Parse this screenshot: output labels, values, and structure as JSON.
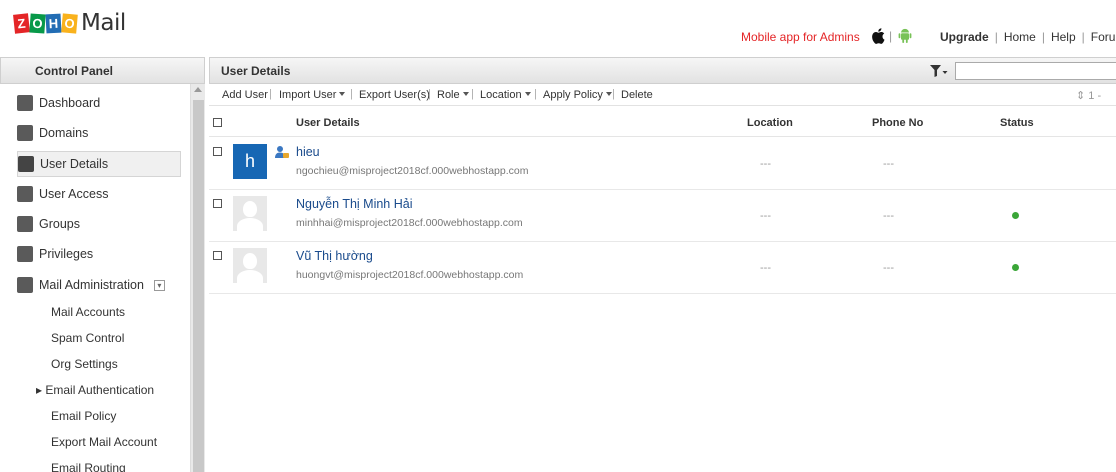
{
  "header": {
    "logo_letters": [
      "Z",
      "O",
      "H",
      "O"
    ],
    "logo_text": "Mail",
    "admin_app_link": "Mobile app for Admins",
    "icon_separator": "|",
    "apple_icon": "apple-icon",
    "android_icon": "android-icon",
    "links": [
      "Upgrade",
      "Home",
      "Help",
      "Forum"
    ],
    "separator": "|",
    "brand_colors": [
      "#e42527",
      "#089949",
      "#226db4",
      "#f9b21d"
    ],
    "accent_red": "#e42527"
  },
  "sidebar": {
    "title": "Control Panel",
    "items": [
      {
        "label": "Dashboard",
        "icon": "dashboard-icon"
      },
      {
        "label": "Domains",
        "icon": "domains-icon"
      },
      {
        "label": "User Details",
        "icon": "user-icon",
        "active": true
      },
      {
        "label": "User Access",
        "icon": "user-access-icon"
      },
      {
        "label": "Groups",
        "icon": "groups-icon"
      },
      {
        "label": "Privileges",
        "icon": "privileges-icon"
      },
      {
        "label": "Mail Administration",
        "icon": "mail-icon"
      }
    ],
    "toggle_glyph": "▾",
    "subitems": [
      {
        "label": "Mail Accounts"
      },
      {
        "label": "Spam Control"
      },
      {
        "label": "Org Settings"
      },
      {
        "label": "▸ Email Authentication"
      },
      {
        "label": "Email Policy"
      },
      {
        "label": "Export Mail Account"
      },
      {
        "label": "Email Routing"
      }
    ]
  },
  "main": {
    "title": "User Details",
    "filter_icon": "filter-icon",
    "search": {
      "value": "",
      "placeholder": ""
    },
    "toolbar": {
      "add_user": "Add User",
      "import_user": "Import User",
      "export_users": "Export User(s)",
      "role": "Role",
      "location": "Location",
      "apply_policy": "Apply Policy",
      "delete": "Delete",
      "separator": "|",
      "pager": "⇕ 1 -"
    },
    "columns": {
      "user_details": "User Details",
      "location": "Location",
      "phone": "Phone No",
      "status": "Status"
    },
    "rows": [
      {
        "avatar_letter": "h",
        "name": "hieu",
        "email": "ngochieu@misproject2018cf.000webhostapp.com",
        "location": "---",
        "phone": "---",
        "is_admin": true,
        "status": ""
      },
      {
        "avatar_letter": "",
        "name": "Nguyễn Thị Minh Hải",
        "email": "minhhai@misproject2018cf.000webhostapp.com",
        "location": "---",
        "phone": "---",
        "is_admin": false,
        "status": "active"
      },
      {
        "avatar_letter": "",
        "name": "Vũ Thị hường",
        "email": "huongvt@misproject2018cf.000webhostapp.com",
        "location": "---",
        "phone": "---",
        "is_admin": false,
        "status": "active"
      }
    ],
    "status_color": "#3aa638",
    "link_color": "#1a4b8c"
  }
}
